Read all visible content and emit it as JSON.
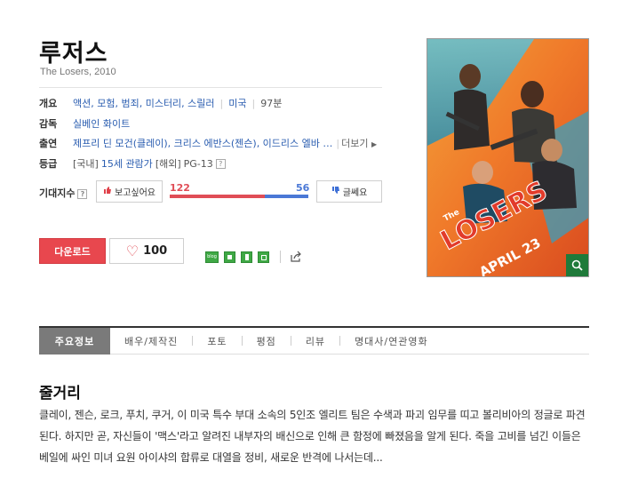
{
  "movie": {
    "title": "루저스",
    "subtitle": "The Losers, 2010"
  },
  "info": {
    "overview_label": "개요",
    "genres": "액션, 모험, 범죄, 미스터리, 스릴러",
    "country": "미국",
    "runtime": "97분",
    "director_label": "감독",
    "director": "실베인 화이트",
    "cast_label": "출연",
    "cast": "제프리 딘 모건(클레이), 크리스 에반스(젠슨), 이드리스 엘바 …",
    "more_label": "더보기",
    "rating_label": "등급",
    "rating_domestic_prefix": "[국내]",
    "rating_domestic": "15세 관람가",
    "rating_overseas_prefix": "[해외]",
    "rating_overseas": "PG-13"
  },
  "expectation": {
    "label": "기대지수",
    "want_label": "보고싶어요",
    "want_count": "122",
    "meh_label": "글쎄요",
    "meh_count": "56",
    "want_fraction": 0.685
  },
  "actions": {
    "download_label": "다운로드",
    "like_count": "100"
  },
  "tabs": [
    {
      "label": "주요정보",
      "active": true
    },
    {
      "label": "배우/제작진",
      "active": false
    },
    {
      "label": "포토",
      "active": false
    },
    {
      "label": "평점",
      "active": false
    },
    {
      "label": "리뷰",
      "active": false
    },
    {
      "label": "명대사/연관영화",
      "active": false
    }
  ],
  "synopsis": {
    "heading": "줄거리",
    "text": "클레이, 젠슨, 로크, 푸치, 쿠거, 이 미국 특수 부대 소속의 5인조 엘리트 팀은 수색과 파괴 임무를 띠고 볼리비아의 정글로 파견된다. 하지만 곧, 자신들이 '맥스'라고 알려진 내부자의 배신으로 인해 큰 함정에 빠졌음을 알게 된다. 죽을 고비를 넘긴 이들은 베일에 싸인 미녀 요원 아이샤의 합류로 대열을 정비, 새로운 반격에 나서는데..."
  },
  "poster": {
    "text_the": "The",
    "text_title": "LOSERS",
    "text_date": "APRIL 23",
    "zoom_icon": "search-icon"
  },
  "colors": {
    "download": "#e8474e",
    "want": "#e04d56",
    "meh": "#4a78d6",
    "share_green": "#3fa845"
  }
}
